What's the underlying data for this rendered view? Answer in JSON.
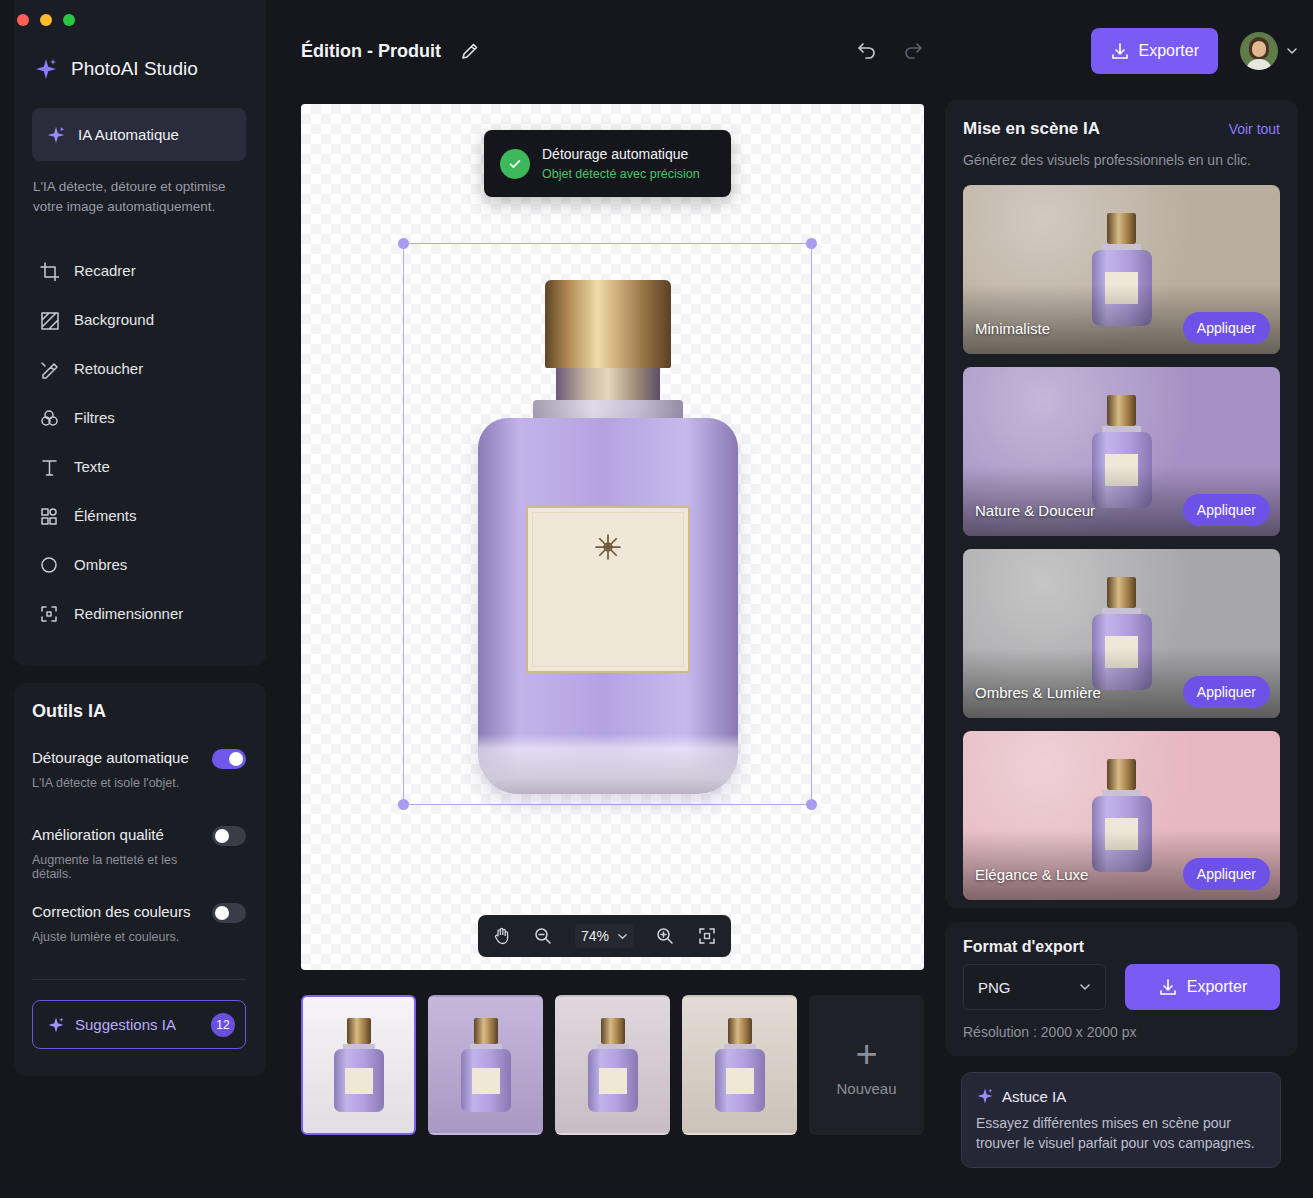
{
  "window": {
    "title": "Édition - Produit"
  },
  "app": {
    "name": "PhotoAI Studio"
  },
  "sidebar": {
    "mode": {
      "label": "IA Automatique",
      "selected": true,
      "description": "L'IA détecte, détoure et optimise votre image automatiquement."
    },
    "items": [
      {
        "label": "Recadrer",
        "selected": false
      },
      {
        "label": "Background",
        "selected": false
      },
      {
        "label": "Retoucher",
        "selected": false
      },
      {
        "label": "Filtres",
        "selected": false
      },
      {
        "label": "Texte",
        "selected": false
      },
      {
        "label": "Éléments",
        "selected": false
      },
      {
        "label": "Ombres",
        "selected": false
      },
      {
        "label": "Redimensionner",
        "selected": false
      }
    ]
  },
  "ai_tools": {
    "title": "Outils IA",
    "toggles": [
      {
        "label": "Détourage automatique",
        "description": "L'IA détecte et isole l'objet.",
        "on": true
      },
      {
        "label": "Amélioration qualité",
        "description": "Augmente la netteté et les détails.",
        "on": false
      },
      {
        "label": "Correction des couleurs",
        "description": "Ajuste lumière et couleurs.",
        "on": false
      }
    ],
    "suggestions": {
      "label": "Suggestions IA",
      "count": "12"
    }
  },
  "header": {
    "export": "Exporter",
    "undo_disabled": false,
    "redo_disabled": true
  },
  "toast": {
    "title": "Détourage automatique",
    "subtitle": "Objet détecté avec précision"
  },
  "zoom": {
    "value": "74%"
  },
  "thumbnails": [
    {
      "selected": true,
      "color": "#f3f1f5"
    },
    {
      "selected": false,
      "color": "#b7a6d4"
    },
    {
      "selected": false,
      "color": "#d9cdd6"
    },
    {
      "selected": false,
      "color": "#dcd3c9"
    }
  ],
  "new_button": {
    "icon": "+",
    "label": "Nouveau"
  },
  "scenes": {
    "title": "Mise en scène IA",
    "link": "Voir tout",
    "subtitle": "Générez des visuels professionnels en un clic.",
    "items": [
      {
        "name": "Minimaliste",
        "action": "Appliquer",
        "color": "#b9ae9f"
      },
      {
        "name": "Nature & Douceur",
        "action": "Appliquer",
        "color": "#a591c4"
      },
      {
        "name": "Ombres & Lumière",
        "action": "Appliquer",
        "color": "#a7a7a9"
      },
      {
        "name": "Elégance & Luxe",
        "action": "Appliquer",
        "color": "#e6b7c0"
      }
    ]
  },
  "export": {
    "title": "Format d'export",
    "format": "PNG",
    "button": "Exporter",
    "resolution": "Résolution : 2000 x 2000 px"
  },
  "tip": {
    "title": "Astuce IA",
    "text": "Essayez différentes mises en scène pour trouver le visuel parfait pour vos campagnes."
  }
}
